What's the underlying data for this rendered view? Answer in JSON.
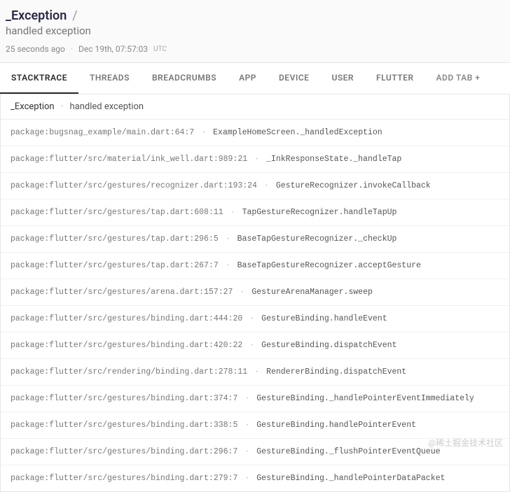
{
  "header": {
    "breadcrumb": "_Exception",
    "breadcrumb_sep": "/",
    "subtitle": "handled exception",
    "relative_time": "25 seconds ago",
    "absolute_time": "Dec 19th, 07:57:03",
    "tz": "UTC"
  },
  "tabs": [
    {
      "label": "STACKTRACE",
      "active": true
    },
    {
      "label": "THREADS",
      "active": false
    },
    {
      "label": "BREADCRUMBS",
      "active": false
    },
    {
      "label": "APP",
      "active": false
    },
    {
      "label": "DEVICE",
      "active": false
    },
    {
      "label": "USER",
      "active": false
    },
    {
      "label": "FLUTTER",
      "active": false
    },
    {
      "label": "ADD TAB +",
      "active": false
    }
  ],
  "summary": {
    "exception": "_Exception",
    "message": "handled exception"
  },
  "stack": [
    {
      "loc": "package:bugsnag_example/main.dart:64:7",
      "fn": "ExampleHomeScreen._handledException"
    },
    {
      "loc": "package:flutter/src/material/ink_well.dart:989:21",
      "fn": "_InkResponseState._handleTap"
    },
    {
      "loc": "package:flutter/src/gestures/recognizer.dart:193:24",
      "fn": "GestureRecognizer.invokeCallback"
    },
    {
      "loc": "package:flutter/src/gestures/tap.dart:608:11",
      "fn": "TapGestureRecognizer.handleTapUp"
    },
    {
      "loc": "package:flutter/src/gestures/tap.dart:296:5",
      "fn": "BaseTapGestureRecognizer._checkUp"
    },
    {
      "loc": "package:flutter/src/gestures/tap.dart:267:7",
      "fn": "BaseTapGestureRecognizer.acceptGesture"
    },
    {
      "loc": "package:flutter/src/gestures/arena.dart:157:27",
      "fn": "GestureArenaManager.sweep"
    },
    {
      "loc": "package:flutter/src/gestures/binding.dart:444:20",
      "fn": "GestureBinding.handleEvent"
    },
    {
      "loc": "package:flutter/src/gestures/binding.dart:420:22",
      "fn": "GestureBinding.dispatchEvent"
    },
    {
      "loc": "package:flutter/src/rendering/binding.dart:278:11",
      "fn": "RendererBinding.dispatchEvent"
    },
    {
      "loc": "package:flutter/src/gestures/binding.dart:374:7",
      "fn": "GestureBinding._handlePointerEventImmediately"
    },
    {
      "loc": "package:flutter/src/gestures/binding.dart:338:5",
      "fn": "GestureBinding.handlePointerEvent"
    },
    {
      "loc": "package:flutter/src/gestures/binding.dart:296:7",
      "fn": "GestureBinding._flushPointerEventQueue"
    },
    {
      "loc": "package:flutter/src/gestures/binding.dart:279:7",
      "fn": "GestureBinding._handlePointerDataPacket"
    }
  ],
  "watermark": "@稀土掘金技术社区"
}
